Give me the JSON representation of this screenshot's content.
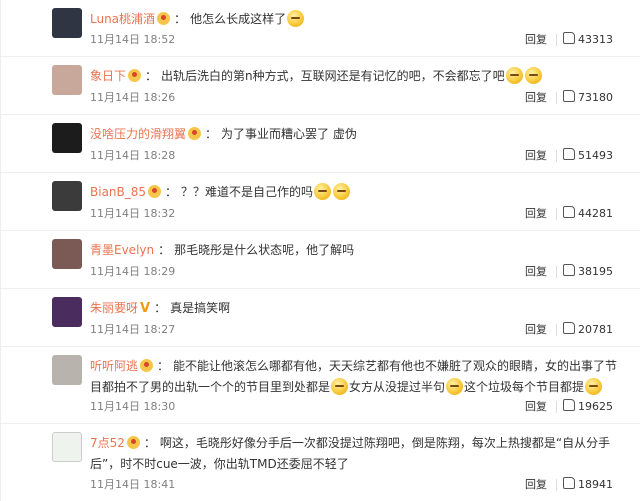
{
  "comments": [
    {
      "user": "Luna桃浦酒",
      "badge": "dot",
      "text": "他怎么长成这样了",
      "emojis": 1,
      "time": "11月14日 18:52",
      "reply": "回复",
      "likes": "43313",
      "avatar_color": "#2f3542"
    },
    {
      "user": "象日下",
      "badge": "dot",
      "text": "出轨后洗白的第n种方式，互联网还是有记忆的吧，不会都忘了吧",
      "emojis": 2,
      "time": "11月14日 18:26",
      "reply": "回复",
      "likes": "73180",
      "avatar_color": "#c8a89a"
    },
    {
      "user": "没啥压力的滑翔翼",
      "badge": "dot",
      "text": "为了事业而糟心罢了 虚伪",
      "emojis": 0,
      "time": "11月14日 18:28",
      "reply": "回复",
      "likes": "51493",
      "avatar_color": "#1c1c1c"
    },
    {
      "user": "BianB_85",
      "badge": "dot",
      "text": "？？难道不是自己作的吗",
      "emojis": 2,
      "time": "11月14日 18:32",
      "reply": "回复",
      "likes": "44281",
      "avatar_color": "#3b3b3b"
    },
    {
      "user": "青墨Evelyn",
      "badge": "none",
      "text": "那毛晓彤是什么状态呢，他了解吗",
      "emojis": 0,
      "time": "11月14日 18:29",
      "reply": "回复",
      "likes": "38195",
      "avatar_color": "#7b5a55"
    },
    {
      "user": "朱丽要呀",
      "badge": "v",
      "text": "真是搞笑啊",
      "emojis": 0,
      "time": "11月14日 18:27",
      "reply": "回复",
      "likes": "20781",
      "avatar_color": "#4a2c5e"
    },
    {
      "user": "听听阿逃",
      "badge": "dot",
      "text": "能不能让他滚怎么哪都有他，天天综艺都有他也不嫌脏了观众的眼睛，女的出事了节目都拍不了男的出轨一个个的节目里到处都是",
      "text2": "女方从没提过半句",
      "text3": "这个垃圾每个节目都提",
      "emojis": 3,
      "time": "11月14日 18:30",
      "reply": "回复",
      "likes": "19625",
      "avatar_color": "#b9b3ad"
    },
    {
      "user": "7点52",
      "badge": "dot",
      "text": "啊这，毛晓彤好像分手后一次都没提过陈翔吧，倒是陈翔，每次上热搜都是“自从分手后”，时不时cue一波，你出轨TMD还委屈不轻了",
      "emojis": 0,
      "time": "11月14日 18:41",
      "reply": "回复",
      "likes": "18941",
      "avatar_color": "#eef3ee"
    }
  ]
}
